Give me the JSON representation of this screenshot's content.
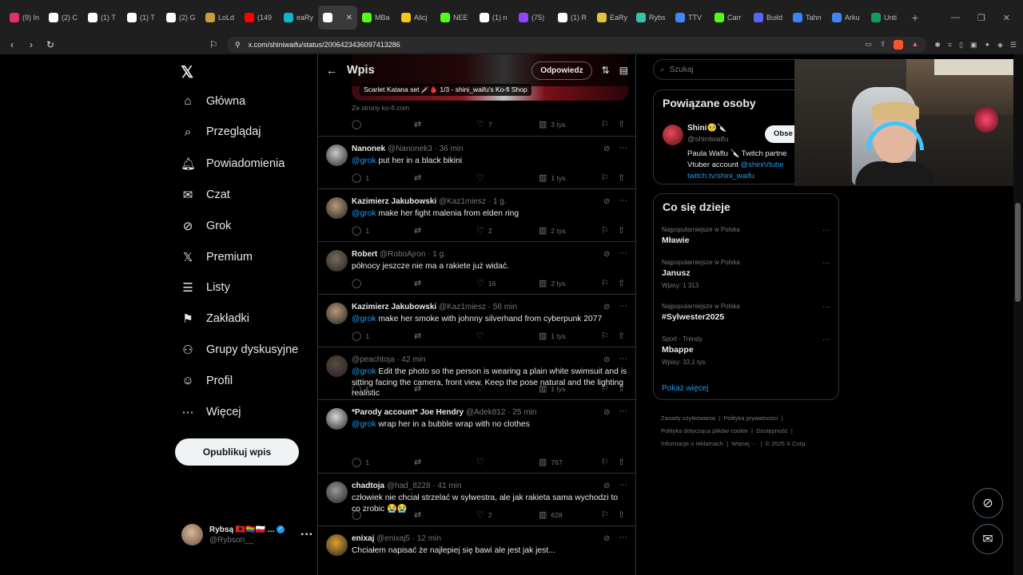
{
  "browser": {
    "tabs": [
      {
        "label": "(9) In",
        "color": "#e1306c"
      },
      {
        "label": "(2) C",
        "color": "#ffffff"
      },
      {
        "label": "(1) T",
        "color": "#ffffff"
      },
      {
        "label": "(1) T",
        "color": "#ffffff"
      },
      {
        "label": "(2) G",
        "color": "#ffffff"
      },
      {
        "label": "LoLd",
        "color": "#c89b3c"
      },
      {
        "label": "(149",
        "color": "#ff0000"
      },
      {
        "label": "eaRy",
        "color": "#12b5cb"
      },
      {
        "label": "",
        "color": "#ffffff",
        "active": true
      },
      {
        "label": "MBa",
        "color": "#53fc18"
      },
      {
        "label": "Alicj",
        "color": "#f5c518"
      },
      {
        "label": "NEE",
        "color": "#53fc18"
      },
      {
        "label": "(1) n",
        "color": "#ffffff"
      },
      {
        "label": "(75)",
        "color": "#9146ff"
      },
      {
        "label": "(1) R",
        "color": "#ffffff"
      },
      {
        "label": "EaRy",
        "color": "#e0c341"
      },
      {
        "label": "Rybs",
        "color": "#36c2a8"
      },
      {
        "label": "TTV",
        "color": "#4285f4"
      },
      {
        "label": "Carr",
        "color": "#53fc18"
      },
      {
        "label": "Build",
        "color": "#5865f2"
      },
      {
        "label": "Tahn",
        "color": "#3b82f6"
      },
      {
        "label": "Arku",
        "color": "#4285f4"
      },
      {
        "label": "Unti",
        "color": "#0f9d58"
      }
    ],
    "active_tab_close": "✕",
    "new_tab": "+",
    "url": "x.com/shiniwaifu/status/2006423436097413286"
  },
  "nav": {
    "items": [
      {
        "label": "Główna",
        "icon": "home-icon",
        "glyph": "⌂"
      },
      {
        "label": "Przeglądaj",
        "icon": "search-icon",
        "glyph": "⌕"
      },
      {
        "label": "Powiadomienia",
        "icon": "bell-icon",
        "glyph": "🔔︎"
      },
      {
        "label": "Czat",
        "icon": "mail-icon",
        "glyph": "✉"
      },
      {
        "label": "Grok",
        "icon": "grok-icon",
        "glyph": "⊘"
      },
      {
        "label": "Premium",
        "icon": "x-premium-icon",
        "glyph": "𝕏"
      },
      {
        "label": "Listy",
        "icon": "list-icon",
        "glyph": "☰"
      },
      {
        "label": "Zakładki",
        "icon": "bookmark-icon",
        "glyph": "⚑"
      },
      {
        "label": "Grupy dyskusyjne",
        "icon": "communities-icon",
        "glyph": "⚇"
      },
      {
        "label": "Profil",
        "icon": "profile-icon",
        "glyph": "☺"
      },
      {
        "label": "Więcej",
        "icon": "more-circle-icon",
        "glyph": "⋯"
      }
    ],
    "publish": "Opublikuj wpis",
    "account": {
      "name": "Rybsą 🇦🇱🏳️‍🌈🇵🇱 ...",
      "handle": "@Rybson__"
    }
  },
  "header": {
    "title": "Wpis",
    "reply": "Odpowiedz"
  },
  "card": {
    "label": "Scarlet Katana set 🗡️🩸 1/3 - shini_waifu's Ko-fi Shop",
    "source": "Ze strony ko-fi.com",
    "likes": "7",
    "views": "3 tys."
  },
  "posts": [
    {
      "name": "Nanonek",
      "meta": "@Nanonek3 · 36 min",
      "mention": "@grok",
      "text": " put her in a black bikini",
      "replies": "1",
      "likes": "",
      "views": "1 tys.",
      "avatar": "#c9c9c9"
    },
    {
      "name": "Kazimierz Jakubowski",
      "meta": "@Kaz1miesz · 1 g.",
      "mention": "@grok",
      "text": " make her fight malenia from elden ring",
      "replies": "1",
      "likes": "2",
      "views": "2 tys.",
      "avatar": "#b89a7a"
    },
    {
      "name": "Robert",
      "meta": "@RoboAjron · 1 g.",
      "mention": "",
      "text": "północy jeszcze nie ma a rakiete już widać.",
      "replies": "",
      "likes": "16",
      "views": "2 tys.",
      "avatar": "#7a6a5a"
    },
    {
      "name": "Kazimierz Jakubowski",
      "meta": "@Kaz1miesz · 56 min",
      "mention": "@grok",
      "text": " make her smoke with johnny silverhand from cyberpunk 2077",
      "replies": "1",
      "likes": "",
      "views": "1 tys.",
      "avatar": "#b89a7a"
    },
    {
      "name": "",
      "meta": "@peachtoja · 42 min",
      "mention": "@grok",
      "text": " Edit the photo so the person is wearing a plain white swimsuit and is sitting facing the camera, front view. Keep the pose natural and the lighting realistic",
      "replies": "1",
      "likes": "",
      "views": "1 tys.",
      "avatar": "#5a4a44"
    },
    {
      "name": "*Parody account* Joe Hendry",
      "meta": "@Adek812 · 25 min",
      "mention": "@grok",
      "text": " wrap her in a bubble wrap with no clothes",
      "replies": "1",
      "likes": "",
      "views": "767",
      "avatar": "#d8d8d8"
    },
    {
      "name": "chadtoja",
      "meta": "@had_8228 · 41 min",
      "mention": "",
      "text": "człowiek nie chciał strzelać w sylwestra, ale jak rakieta sama wychodzi to co zrobic 😭😭",
      "replies": "",
      "likes": "2",
      "views": "628",
      "avatar": "#9a9a9a"
    },
    {
      "name": "enixaj",
      "meta": "@enixaj5 · 12 min",
      "mention": "",
      "text": "Chciałem napisać że najlepiej się bawi ale jest jak jest...",
      "replies": "",
      "likes": "",
      "views": "",
      "avatar": "#e0a030"
    }
  ],
  "search": {
    "placeholder": "Szukaj"
  },
  "related": {
    "title": "Powiązane osoby",
    "name": "Shini🥺🔪",
    "handle": "@shiniwaifu",
    "follow": "Obse",
    "bio_1": "Paula Waflu 🔪 Twitch partne",
    "bio_2": "Vtuber account ",
    "bio_mention": "@shiniVtube",
    "bio_link": "twitch.tv/shini_waifu"
  },
  "trends": {
    "title": "Co się dzieje",
    "items": [
      {
        "context": "Najpopularniejsze w Polska",
        "name": "Mławie",
        "count": ""
      },
      {
        "context": "Najpopularniejsze w Polska",
        "name": "Janusz",
        "count": "Wpisy: 1 313"
      },
      {
        "context": "Najpopularniejsze w Polska",
        "name": "#Sylwester2025",
        "count": ""
      },
      {
        "context": "Sport · Trendy",
        "name": "Mbappe",
        "count": "Wpisy: 33,1 tys."
      }
    ],
    "show_more": "Pokaż więcej"
  },
  "footer": {
    "l1a": "Zasady użytkowania",
    "l1b": "Polityka prywatności",
    "l2a": "Polityka dotycząca plików cookie",
    "l2b": "Dostępność",
    "l3a": "Informacje o reklamach",
    "l3b": "Więcej ···",
    "copy": "© 2025 X Corp."
  }
}
